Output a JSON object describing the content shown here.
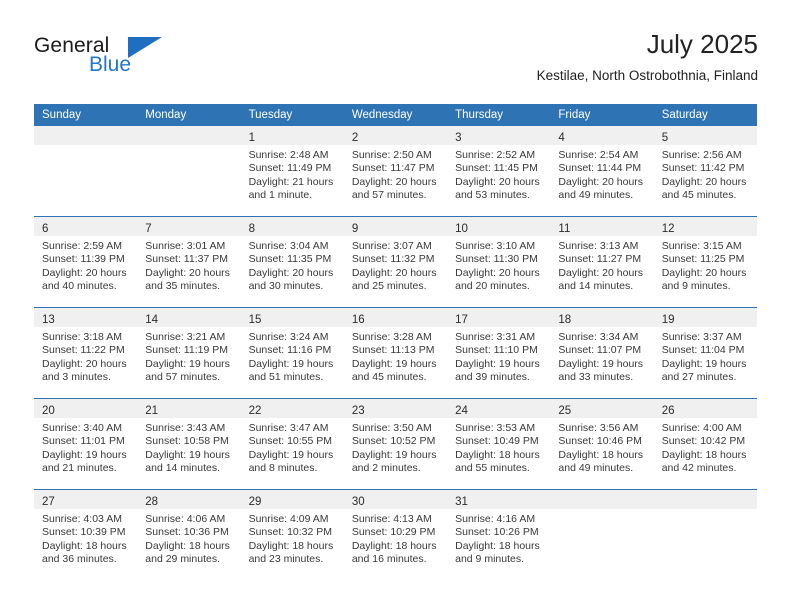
{
  "brand": {
    "word_one": "General",
    "word_two": "Blue",
    "mark": "triangle-logo"
  },
  "header": {
    "title": "July 2025",
    "location": "Kestilae, North Ostrobothnia, Finland"
  },
  "colors": {
    "header_blue": "#2E74B5",
    "brand_blue": "#2277C8",
    "daynum_band": "#F0F0F0",
    "text": "#3A3A3A"
  },
  "weekday_headers": [
    "Sunday",
    "Monday",
    "Tuesday",
    "Wednesday",
    "Thursday",
    "Friday",
    "Saturday"
  ],
  "weeks": [
    [
      {
        "day": "",
        "lines": []
      },
      {
        "day": "",
        "lines": []
      },
      {
        "day": "1",
        "lines": [
          "Sunrise: 2:48 AM",
          "Sunset: 11:49 PM",
          "Daylight: 21 hours",
          "and 1 minute."
        ]
      },
      {
        "day": "2",
        "lines": [
          "Sunrise: 2:50 AM",
          "Sunset: 11:47 PM",
          "Daylight: 20 hours",
          "and 57 minutes."
        ]
      },
      {
        "day": "3",
        "lines": [
          "Sunrise: 2:52 AM",
          "Sunset: 11:45 PM",
          "Daylight: 20 hours",
          "and 53 minutes."
        ]
      },
      {
        "day": "4",
        "lines": [
          "Sunrise: 2:54 AM",
          "Sunset: 11:44 PM",
          "Daylight: 20 hours",
          "and 49 minutes."
        ]
      },
      {
        "day": "5",
        "lines": [
          "Sunrise: 2:56 AM",
          "Sunset: 11:42 PM",
          "Daylight: 20 hours",
          "and 45 minutes."
        ]
      }
    ],
    [
      {
        "day": "6",
        "lines": [
          "Sunrise: 2:59 AM",
          "Sunset: 11:39 PM",
          "Daylight: 20 hours",
          "and 40 minutes."
        ]
      },
      {
        "day": "7",
        "lines": [
          "Sunrise: 3:01 AM",
          "Sunset: 11:37 PM",
          "Daylight: 20 hours",
          "and 35 minutes."
        ]
      },
      {
        "day": "8",
        "lines": [
          "Sunrise: 3:04 AM",
          "Sunset: 11:35 PM",
          "Daylight: 20 hours",
          "and 30 minutes."
        ]
      },
      {
        "day": "9",
        "lines": [
          "Sunrise: 3:07 AM",
          "Sunset: 11:32 PM",
          "Daylight: 20 hours",
          "and 25 minutes."
        ]
      },
      {
        "day": "10",
        "lines": [
          "Sunrise: 3:10 AM",
          "Sunset: 11:30 PM",
          "Daylight: 20 hours",
          "and 20 minutes."
        ]
      },
      {
        "day": "11",
        "lines": [
          "Sunrise: 3:13 AM",
          "Sunset: 11:27 PM",
          "Daylight: 20 hours",
          "and 14 minutes."
        ]
      },
      {
        "day": "12",
        "lines": [
          "Sunrise: 3:15 AM",
          "Sunset: 11:25 PM",
          "Daylight: 20 hours",
          "and 9 minutes."
        ]
      }
    ],
    [
      {
        "day": "13",
        "lines": [
          "Sunrise: 3:18 AM",
          "Sunset: 11:22 PM",
          "Daylight: 20 hours",
          "and 3 minutes."
        ]
      },
      {
        "day": "14",
        "lines": [
          "Sunrise: 3:21 AM",
          "Sunset: 11:19 PM",
          "Daylight: 19 hours",
          "and 57 minutes."
        ]
      },
      {
        "day": "15",
        "lines": [
          "Sunrise: 3:24 AM",
          "Sunset: 11:16 PM",
          "Daylight: 19 hours",
          "and 51 minutes."
        ]
      },
      {
        "day": "16",
        "lines": [
          "Sunrise: 3:28 AM",
          "Sunset: 11:13 PM",
          "Daylight: 19 hours",
          "and 45 minutes."
        ]
      },
      {
        "day": "17",
        "lines": [
          "Sunrise: 3:31 AM",
          "Sunset: 11:10 PM",
          "Daylight: 19 hours",
          "and 39 minutes."
        ]
      },
      {
        "day": "18",
        "lines": [
          "Sunrise: 3:34 AM",
          "Sunset: 11:07 PM",
          "Daylight: 19 hours",
          "and 33 minutes."
        ]
      },
      {
        "day": "19",
        "lines": [
          "Sunrise: 3:37 AM",
          "Sunset: 11:04 PM",
          "Daylight: 19 hours",
          "and 27 minutes."
        ]
      }
    ],
    [
      {
        "day": "20",
        "lines": [
          "Sunrise: 3:40 AM",
          "Sunset: 11:01 PM",
          "Daylight: 19 hours",
          "and 21 minutes."
        ]
      },
      {
        "day": "21",
        "lines": [
          "Sunrise: 3:43 AM",
          "Sunset: 10:58 PM",
          "Daylight: 19 hours",
          "and 14 minutes."
        ]
      },
      {
        "day": "22",
        "lines": [
          "Sunrise: 3:47 AM",
          "Sunset: 10:55 PM",
          "Daylight: 19 hours",
          "and 8 minutes."
        ]
      },
      {
        "day": "23",
        "lines": [
          "Sunrise: 3:50 AM",
          "Sunset: 10:52 PM",
          "Daylight: 19 hours",
          "and 2 minutes."
        ]
      },
      {
        "day": "24",
        "lines": [
          "Sunrise: 3:53 AM",
          "Sunset: 10:49 PM",
          "Daylight: 18 hours",
          "and 55 minutes."
        ]
      },
      {
        "day": "25",
        "lines": [
          "Sunrise: 3:56 AM",
          "Sunset: 10:46 PM",
          "Daylight: 18 hours",
          "and 49 minutes."
        ]
      },
      {
        "day": "26",
        "lines": [
          "Sunrise: 4:00 AM",
          "Sunset: 10:42 PM",
          "Daylight: 18 hours",
          "and 42 minutes."
        ]
      }
    ],
    [
      {
        "day": "27",
        "lines": [
          "Sunrise: 4:03 AM",
          "Sunset: 10:39 PM",
          "Daylight: 18 hours",
          "and 36 minutes."
        ]
      },
      {
        "day": "28",
        "lines": [
          "Sunrise: 4:06 AM",
          "Sunset: 10:36 PM",
          "Daylight: 18 hours",
          "and 29 minutes."
        ]
      },
      {
        "day": "29",
        "lines": [
          "Sunrise: 4:09 AM",
          "Sunset: 10:32 PM",
          "Daylight: 18 hours",
          "and 23 minutes."
        ]
      },
      {
        "day": "30",
        "lines": [
          "Sunrise: 4:13 AM",
          "Sunset: 10:29 PM",
          "Daylight: 18 hours",
          "and 16 minutes."
        ]
      },
      {
        "day": "31",
        "lines": [
          "Sunrise: 4:16 AM",
          "Sunset: 10:26 PM",
          "Daylight: 18 hours",
          "and 9 minutes."
        ]
      },
      {
        "day": "",
        "lines": []
      },
      {
        "day": "",
        "lines": []
      }
    ]
  ]
}
